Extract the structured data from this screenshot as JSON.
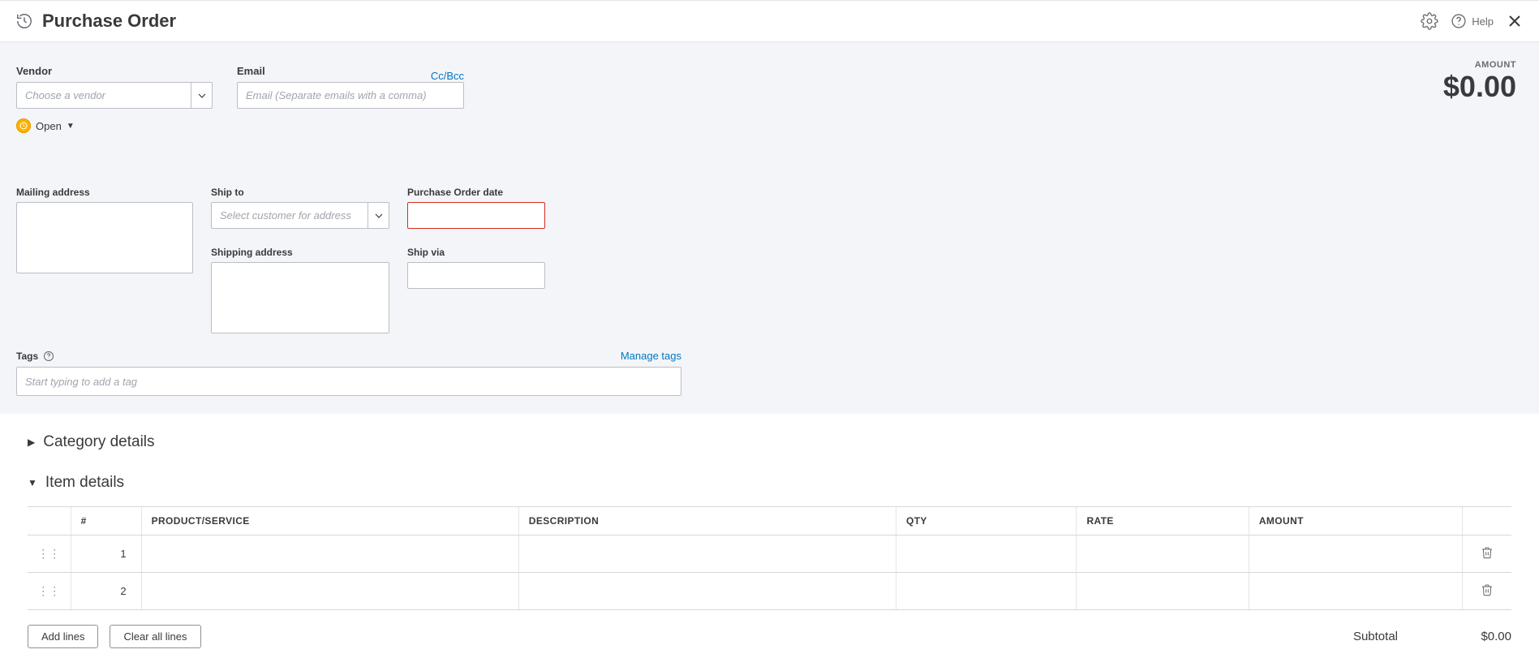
{
  "header": {
    "title": "Purchase Order",
    "help_label": "Help"
  },
  "form": {
    "vendor_label": "Vendor",
    "vendor_placeholder": "Choose a vendor",
    "email_label": "Email",
    "email_placeholder": "Email (Separate emails with a comma)",
    "ccbcc_link": "Cc/Bcc",
    "status_text": "Open",
    "amount_label": "AMOUNT",
    "amount_value": "$0.00",
    "mailing_label": "Mailing address",
    "shipto_label": "Ship to",
    "shipto_placeholder": "Select customer for address",
    "shipping_label": "Shipping address",
    "po_date_label": "Purchase Order date",
    "ship_via_label": "Ship via",
    "tags_label": "Tags",
    "manage_tags_link": "Manage tags",
    "tags_placeholder": "Start typing to add a tag"
  },
  "sections": {
    "category_title": "Category details",
    "item_title": "Item details"
  },
  "item_table": {
    "headers": {
      "num": "#",
      "product": "PRODUCT/SERVICE",
      "description": "DESCRIPTION",
      "qty": "QTY",
      "rate": "RATE",
      "amount": "AMOUNT"
    },
    "rows": [
      {
        "num": "1"
      },
      {
        "num": "2"
      }
    ]
  },
  "buttons": {
    "add_lines": "Add lines",
    "clear_lines": "Clear all lines"
  },
  "totals": {
    "subtotal_label": "Subtotal",
    "subtotal_value": "$0.00"
  }
}
